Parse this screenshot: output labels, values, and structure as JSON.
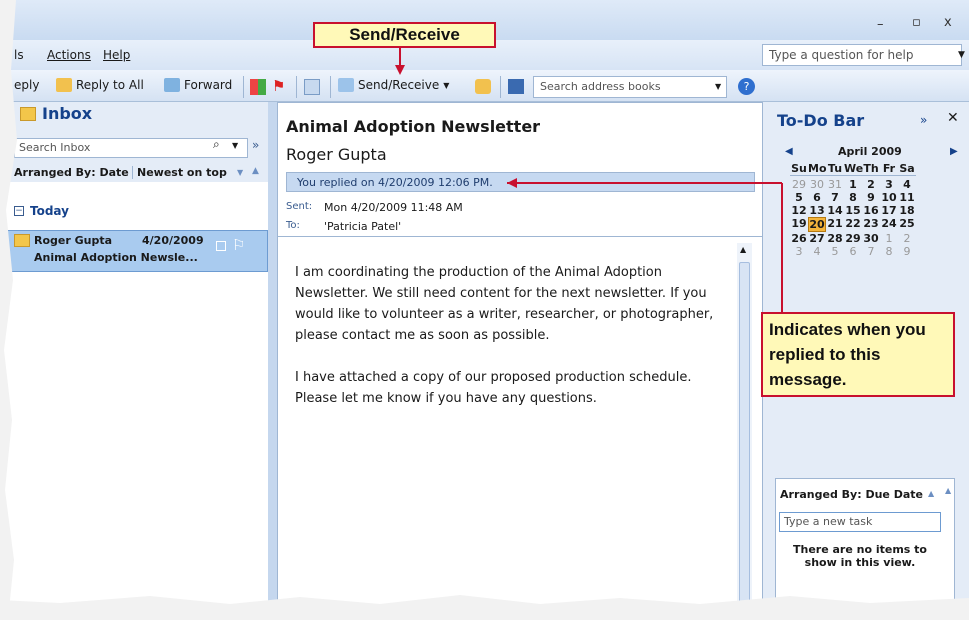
{
  "window": {
    "minimize_glyph": "–",
    "maximize_glyph": "▫",
    "close_glyph": "x"
  },
  "menu": {
    "items": [
      "ls",
      "Actions",
      "Help"
    ],
    "help_placeholder": "Type a question for help"
  },
  "toolbar": {
    "reply": "eply",
    "reply_all": "Reply to All",
    "forward": "Forward",
    "send_receive": "Send/Receive",
    "search_address_books": "Search address books"
  },
  "inbox": {
    "title": "Inbox",
    "search_placeholder": "Search Inbox",
    "arranged_by": "Arranged By: Date",
    "sort_order": "Newest on top",
    "group_today": "Today",
    "messages": [
      {
        "sender": "Roger Gupta",
        "date": "4/20/2009",
        "subject": "Animal Adoption Newsle..."
      }
    ]
  },
  "reading": {
    "subject": "Animal Adoption Newsletter",
    "from": "Roger Gupta",
    "info_bar": "You replied on 4/20/2009 12:06 PM.",
    "sent_label": "Sent:",
    "sent_value": "Mon 4/20/2009 11:48 AM",
    "to_label": "To:",
    "to_value": "'Patricia Patel'",
    "body_p1": "I am coordinating the production of the Animal Adoption Newsletter. We still need content for the next newsletter. If you would like to volunteer as a writer, researcher, or photographer, please contact me as soon as possible.",
    "body_p2": "I have attached a copy of our proposed production schedule. Please let me know if you have any questions."
  },
  "todo": {
    "title": "To-Do Bar",
    "month": "April 2009",
    "weekdays": [
      "Su",
      "Mo",
      "Tu",
      "We",
      "Th",
      "Fr",
      "Sa"
    ],
    "weeks": [
      [
        "29",
        "30",
        "31",
        "1",
        "2",
        "3",
        "4"
      ],
      [
        "5",
        "6",
        "7",
        "8",
        "9",
        "10",
        "11"
      ],
      [
        "12",
        "13",
        "14",
        "15",
        "16",
        "17",
        "18"
      ],
      [
        "19",
        "20",
        "21",
        "22",
        "23",
        "24",
        "25"
      ],
      [
        "26",
        "27",
        "28",
        "29",
        "30",
        "1",
        "2"
      ],
      [
        "3",
        "4",
        "5",
        "6",
        "7",
        "8",
        "9"
      ]
    ],
    "today": "20",
    "tasks_arranged": "Arranged By: Due Date",
    "new_task_placeholder": "Type a new task",
    "empty_message": "There are no items to show in this view."
  },
  "callouts": {
    "send_receive": "Send/Receive",
    "replied": "Indicates when you replied to this message."
  },
  "colors": {
    "accent": "#15428b",
    "callout_border": "#c8102e",
    "callout_fill": "#fff9b8",
    "today_fill": "#f3b43b"
  }
}
